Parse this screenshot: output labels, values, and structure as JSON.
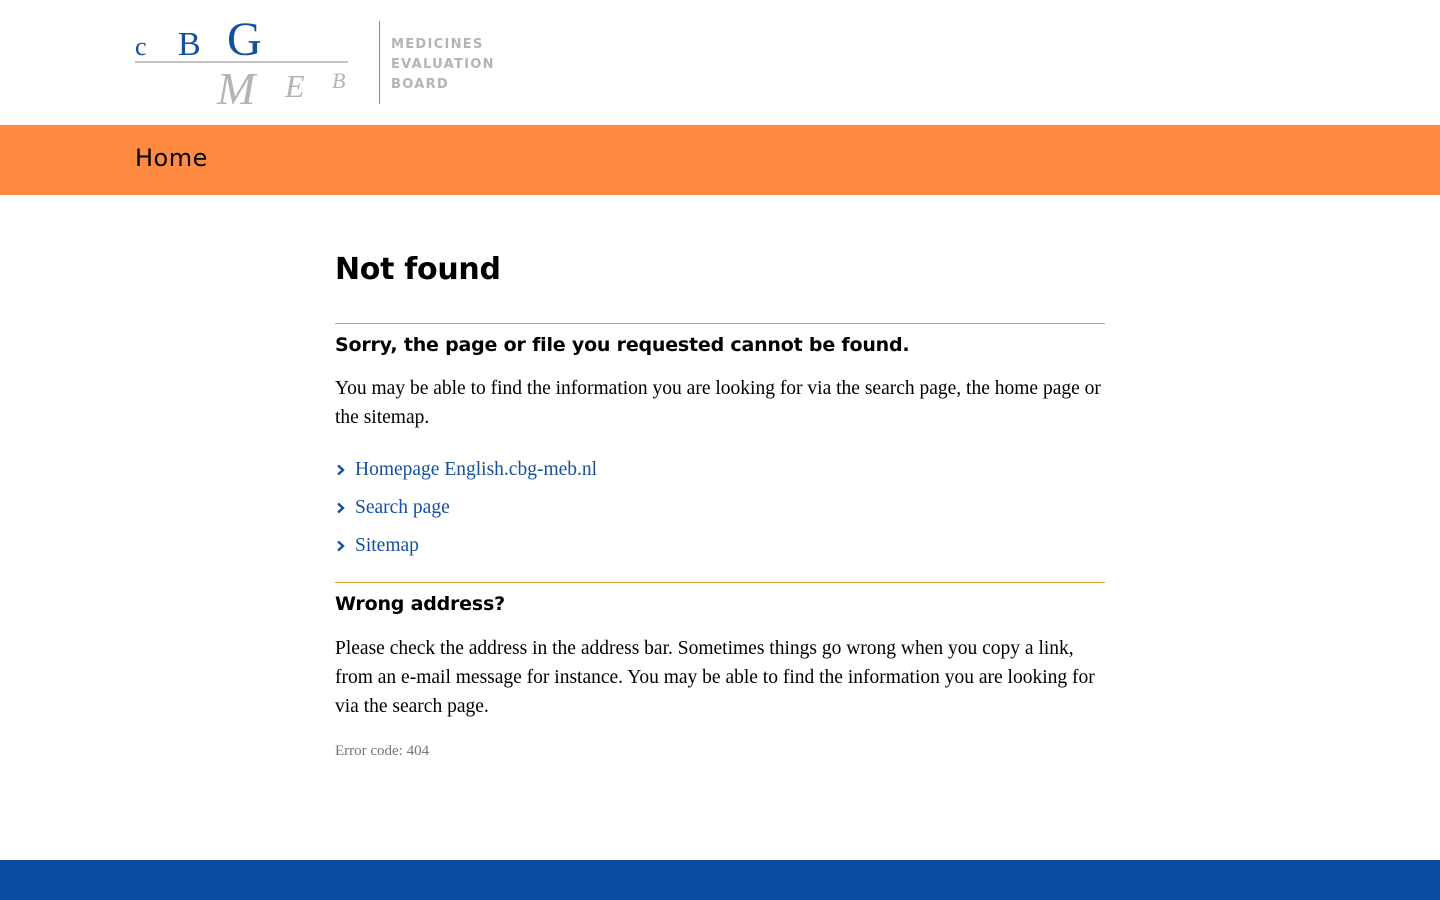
{
  "header": {
    "logo_alt": "CBG MEB",
    "logo_words": [
      "MEDICINES",
      "EVALUATION",
      "BOARD"
    ]
  },
  "nav": {
    "home_label": "Home"
  },
  "main": {
    "title": "Not found",
    "section1": {
      "heading": "Sorry, the page or file you requested cannot be found.",
      "text": "You may be able to find the information you are looking for via the search page, the home page or the sitemap.",
      "links": [
        {
          "label": "Homepage English.cbg-meb.nl"
        },
        {
          "label": "Search page"
        },
        {
          "label": "Sitemap"
        }
      ]
    },
    "section2": {
      "heading": "Wrong address?",
      "text": "Please check the address in the address bar. Sometimes things go wrong when you copy a link, from an e-mail message for instance. You may be able to find the information you are looking for via the search page."
    },
    "error_code": "Error code: 404"
  },
  "colors": {
    "brand_orange": "#ff8b42",
    "brand_blue": "#0b4ca3",
    "link_blue": "#1550a0",
    "rule_gold": "#e0a23e",
    "logo_grey": "#b4b4b4"
  },
  "icons": {
    "link_bullet": "chevron-right-icon"
  }
}
